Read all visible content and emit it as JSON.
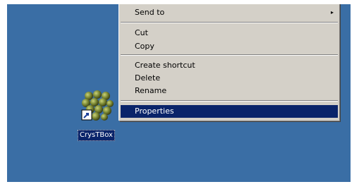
{
  "menu": {
    "items": [
      {
        "label": "Send to",
        "submenu_arrow": "▸"
      },
      {
        "label": "Cut"
      },
      {
        "label": "Copy"
      },
      {
        "label": "Create shortcut"
      },
      {
        "label": "Delete"
      },
      {
        "label": "Rename"
      },
      {
        "label": "Properties"
      }
    ]
  },
  "desktop_icon": {
    "label": "CrysTBox",
    "icon": "crystal-lattice-shortcut-icon"
  },
  "colors": {
    "desktop": "#3a6ea5",
    "menu_bg": "#d4d0c8",
    "selection": "#0a246a"
  }
}
